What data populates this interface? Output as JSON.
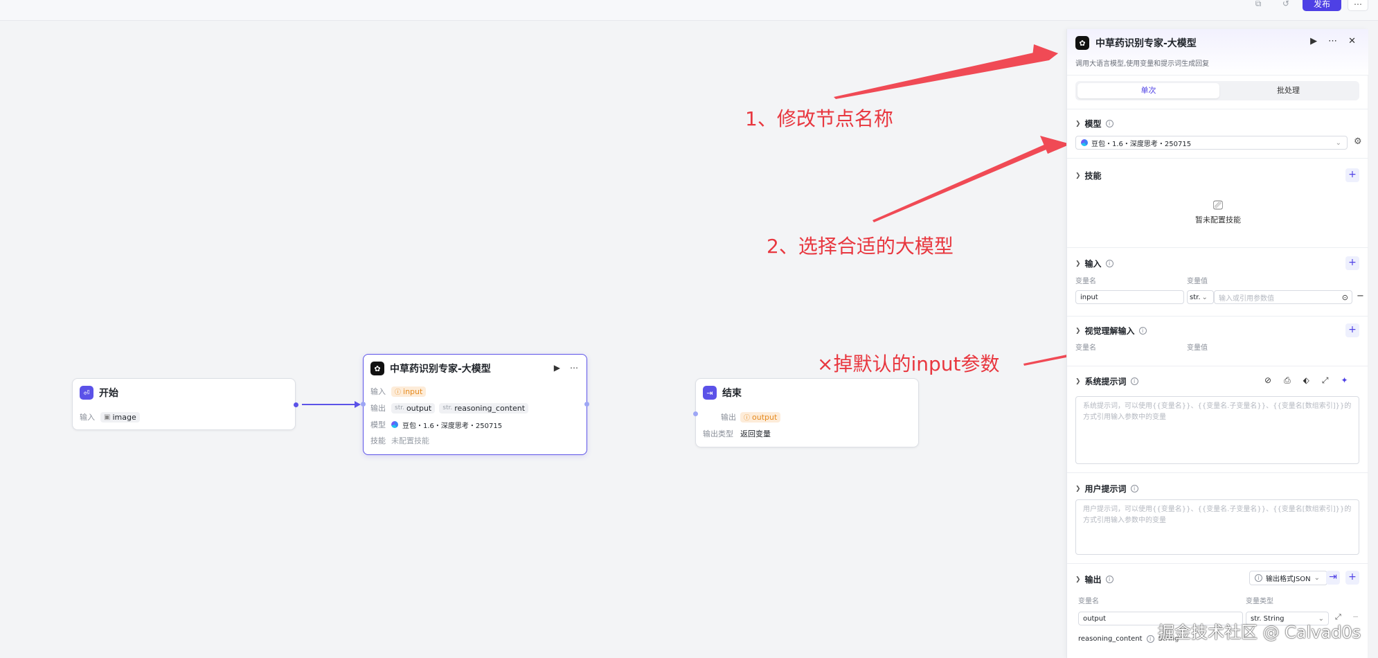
{
  "toolbar": {
    "publish_label": "发布",
    "more_label": "⋯"
  },
  "canvas": {
    "start_node": {
      "title": "开始",
      "input_label": "输入",
      "input_var": "image"
    },
    "llm_node": {
      "title": "中草药识别专家-大模型",
      "input_label": "输入",
      "input_var": "input",
      "output_label": "输出",
      "output_prefix": "str.",
      "output_var1": "output",
      "output_var2": "reasoning_content",
      "model_label": "模型",
      "model_value": "豆包・1.6・深度思考・250715",
      "skill_label": "技能",
      "skill_value": "未配置技能"
    },
    "end_node": {
      "title": "结束",
      "output_label": "输出",
      "output_var": "output",
      "output_type_label": "输出类型",
      "output_type_value": "返回变量"
    }
  },
  "annotations": {
    "a1": "1、修改节点名称",
    "a2": "2、选择合适的大模型",
    "a3": "×掉默认的input参数"
  },
  "panel": {
    "title": "中草药识别专家-大模型",
    "description": "调用大语言模型,使用变量和提示词生成回复",
    "tabs": [
      "单次",
      "批处理"
    ],
    "model_section": {
      "label": "模型",
      "value": "豆包・1.6・深度思考・250715"
    },
    "skills_section": {
      "label": "技能",
      "empty_text": "暂未配置技能"
    },
    "input_section": {
      "label": "输入",
      "col_name": "变量名",
      "col_value": "变量值",
      "var_name": "input",
      "type": "str.",
      "placeholder": "输入或引用参数值"
    },
    "visual_section": {
      "label": "视觉理解输入",
      "col_name": "变量名",
      "col_value": "变量值"
    },
    "system_prompt": {
      "label": "系统提示词",
      "placeholder": "系统提示词，可以使用{{变量名}}、{{变量名.子变量名}}、{{变量名[数组索引]}}的方式引用输入参数中的变量"
    },
    "user_prompt": {
      "label": "用户提示词",
      "placeholder": "用户提示词，可以使用{{变量名}}、{{变量名.子变量名}}、{{变量名[数组索引]}}的方式引用输入参数中的变量"
    },
    "output_section": {
      "label": "输出",
      "format_label": "输出格式JSON",
      "col_name": "变量名",
      "col_type": "变量类型",
      "var1": "output",
      "type1": "str. String",
      "var2": "reasoning_content",
      "type2": "String"
    }
  },
  "watermark": "掘金技术社区 @ Calvad0s",
  "colors": {
    "accent": "#4e40e5",
    "annotation": "#e8373f",
    "chip_orange": "#e58a1f"
  }
}
